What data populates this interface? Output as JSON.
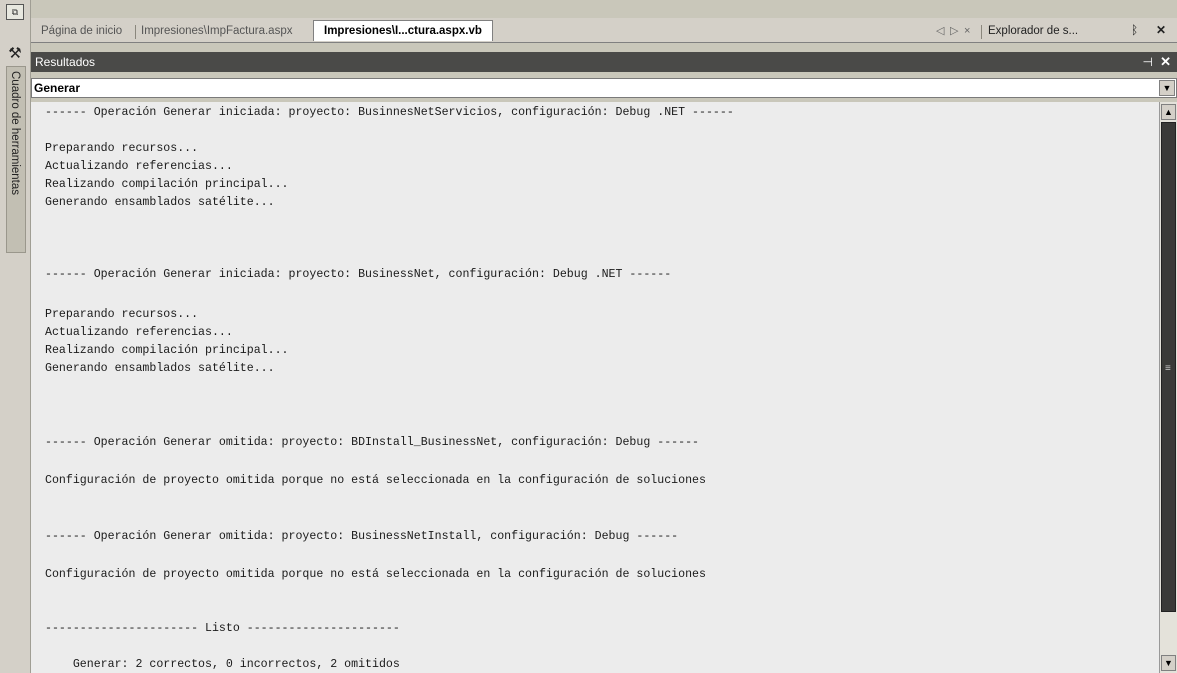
{
  "tabs": {
    "items": [
      "Página de inicio",
      "Impresiones\\ImpFactura.aspx",
      "Impresiones\\I...ctura.aspx.vb"
    ],
    "nav_prev": "◁",
    "nav_next": "▷",
    "nav_close": "×",
    "solution_explorer": "Explorador de s...",
    "pin": "ᛒ",
    "close": "✕"
  },
  "left_strip": {
    "toolbox_label": "Cuadro de herramientas"
  },
  "panel": {
    "title": "Resultados",
    "combo_value": "Generar"
  },
  "output_lines": [
    "------ Operación Generar iniciada: proyecto: BusinnesNetServicios, configuración: Debug .NET ------",
    "",
    "Preparando recursos...",
    "Actualizando referencias...",
    "Realizando compilación principal...",
    "Generando ensamblados satélite...",
    "",
    "",
    "",
    "------ Operación Generar iniciada: proyecto: BusinessNet, configuración: Debug .NET ------",
    "",
    "Preparando recursos...",
    "Actualizando referencias...",
    "Realizando compilación principal...",
    "Generando ensamblados satélite...",
    "",
    "",
    "",
    "------ Operación Generar omitida: proyecto: BDInstall_BusinessNet, configuración: Debug ------",
    "",
    "Configuración de proyecto omitida porque no está seleccionada en la configuración de soluciones",
    "",
    "",
    "------ Operación Generar omitida: proyecto: BusinessNetInstall, configuración: Debug ------",
    "",
    "Configuración de proyecto omitida porque no está seleccionada en la configuración de soluciones",
    "",
    "",
    "---------------------- Listo ----------------------",
    "",
    "    Generar: 2 correctos, 0 incorrectos, 2 omitidos"
  ]
}
